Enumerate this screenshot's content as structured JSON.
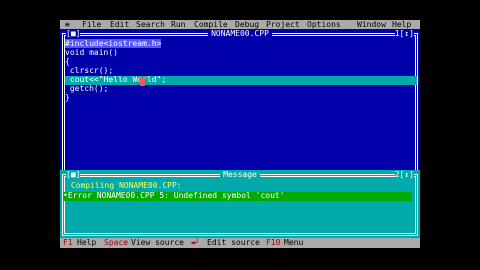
{
  "menu": {
    "system": "≡",
    "items": [
      "File",
      "Edit",
      "Search",
      "Run",
      "Compile",
      "Debug",
      "Project",
      "Options",
      "Window",
      "Help"
    ]
  },
  "editor": {
    "title": "NONAME00.CPP",
    "close_box": "[■]",
    "window_number": "1",
    "zoom_box": "[↕]",
    "lines": [
      "#include<iostream.h>",
      "void main()",
      "{",
      " clrscr();",
      " cout<<\"Hello World\";",
      " getch();",
      "}"
    ]
  },
  "message": {
    "title": "Message",
    "close_box": "[■]",
    "window_number": "2",
    "zoom_box": "[↕]",
    "lines": [
      " Compiling NONAME00.CPP:",
      "•Error NONAME00.CPP 5: Undefined symbol 'cout'"
    ]
  },
  "status": {
    "f1_key": "F1",
    "f1_label": "Help",
    "space_key": "Space",
    "space_label": "View source",
    "enter_key": "◄┘",
    "enter_label": "Edit source",
    "f10_key": "F10",
    "f10_label": "Menu"
  },
  "colors": {
    "background": "#0000aa",
    "menubar": "#aaaaaa",
    "highlight": "#00aaaa",
    "error_line": "#00aa00",
    "hotkey": "#aa0000"
  }
}
